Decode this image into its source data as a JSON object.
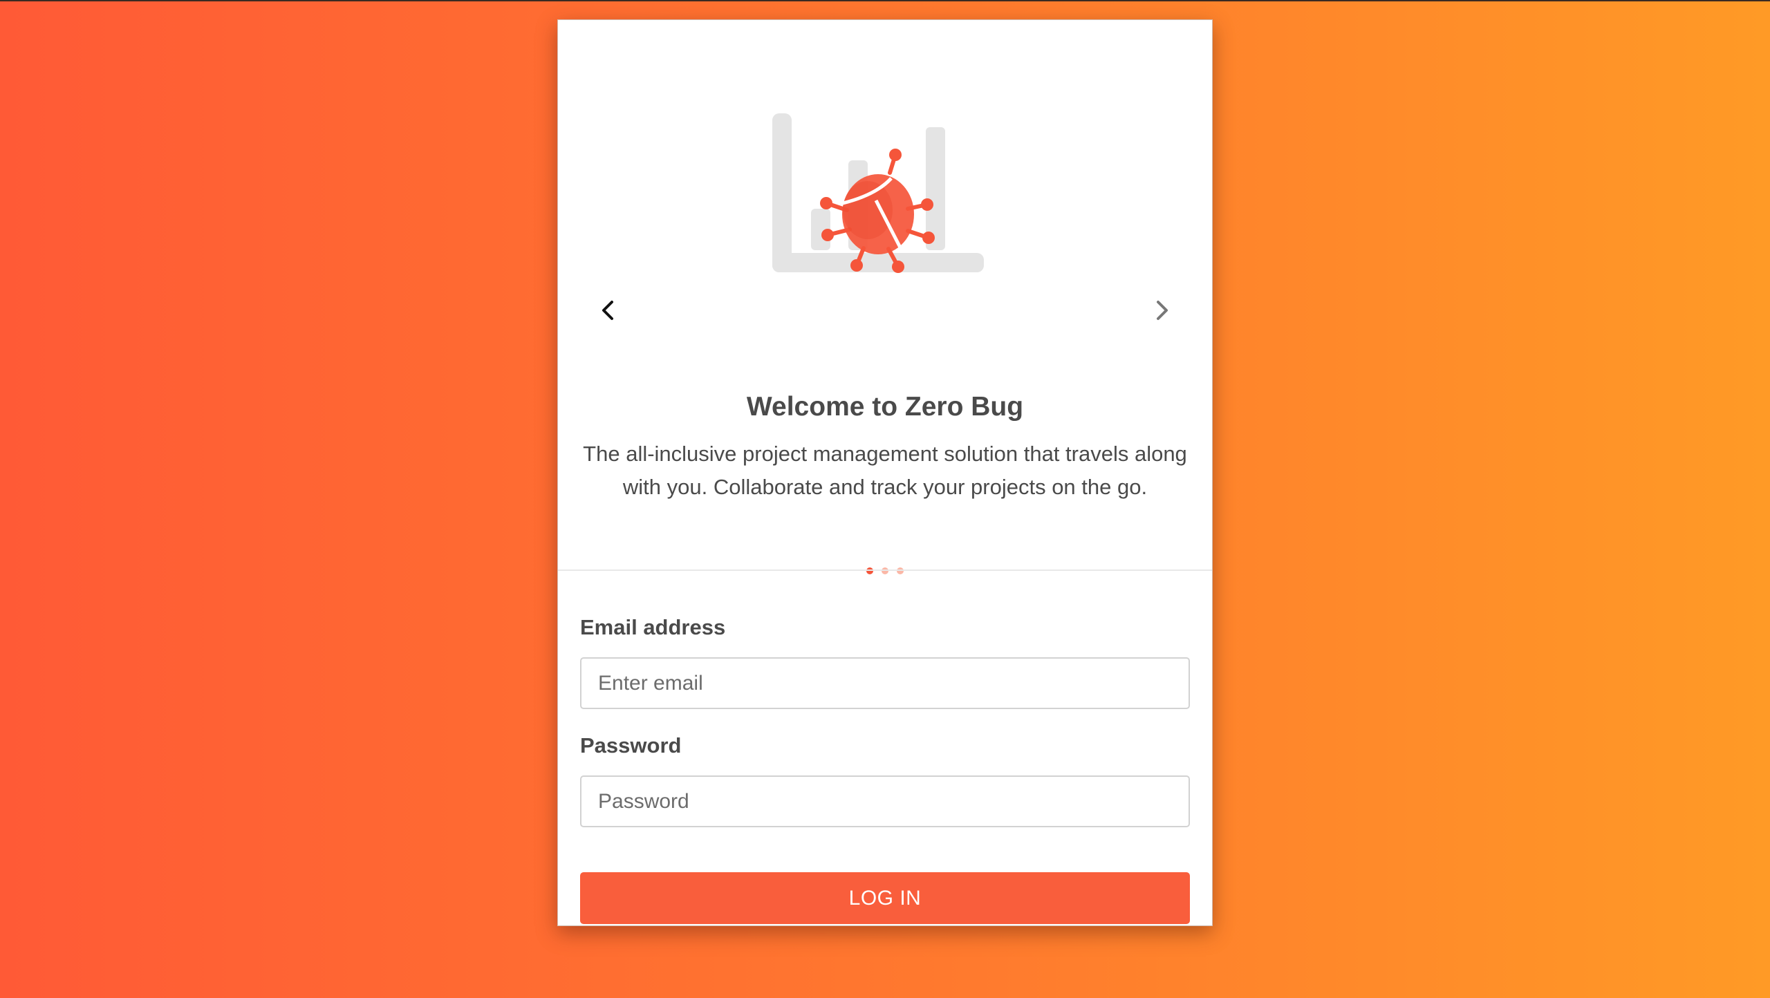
{
  "carousel": {
    "title": "Welcome to Zero Bug",
    "description_lines": [
      "The all-inclusive project management solution that travels along",
      "with you. Collaborate and track your projects on the go."
    ],
    "slide_count": 3,
    "active_slide": 1,
    "prev_icon": "chevron-left-icon",
    "next_icon": "chevron-right-icon",
    "illustration": "bug-chart-illustration"
  },
  "form": {
    "email_label": "Email address",
    "email_placeholder": "Enter email",
    "password_label": "Password",
    "password_placeholder": "Password",
    "submit_label": "LOG IN"
  },
  "colors": {
    "accent": "#f95e3c",
    "background_start": "#ff5a36",
    "background_end": "#ff9a26",
    "text": "#4a4a4a"
  }
}
